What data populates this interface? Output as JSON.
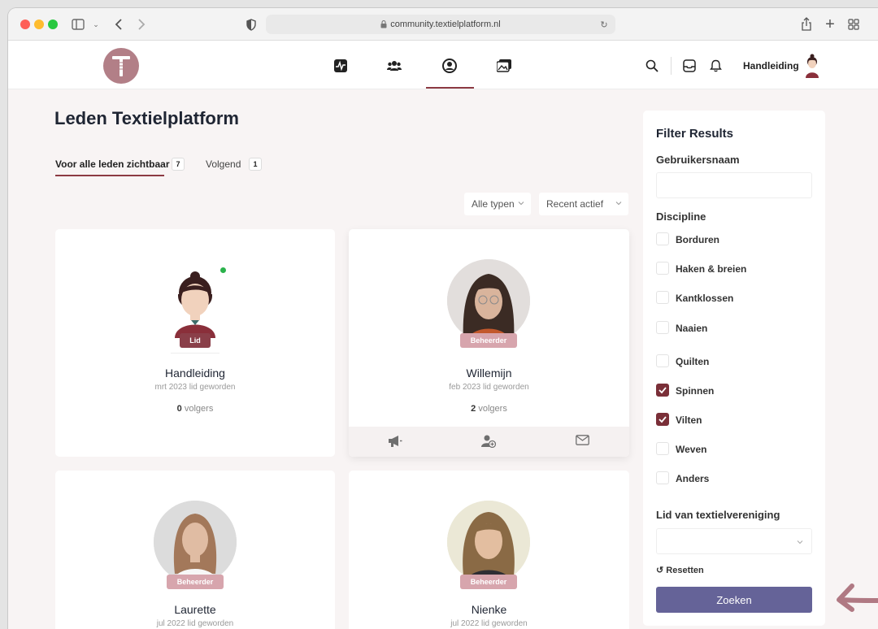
{
  "browser": {
    "url": "community.textielplatform.nl"
  },
  "header": {
    "user_name": "Handleiding"
  },
  "page": {
    "title": "Leden Textielplatform"
  },
  "tabs": [
    {
      "label": "Voor alle leden zichtbaar",
      "count": "7"
    },
    {
      "label": "Volgend",
      "count": "1"
    }
  ],
  "selects": {
    "type": "Alle typen",
    "sort": "Recent actief"
  },
  "members": [
    {
      "name": "Handleiding",
      "badge": "Lid",
      "joined": "mrt 2023 lid geworden",
      "followers": "0",
      "followers_label": "volgers"
    },
    {
      "name": "Willemijn",
      "badge": "Beheerder",
      "joined": "feb 2023 lid geworden",
      "followers": "2",
      "followers_label": "volgers"
    },
    {
      "name": "Laurette",
      "badge": "Beheerder",
      "joined": "jul 2022 lid geworden"
    },
    {
      "name": "Nienke",
      "badge": "Beheerder",
      "joined": "jul 2022 lid geworden"
    }
  ],
  "filter": {
    "title": "Filter Results",
    "username_label": "Gebruikersnaam",
    "username_value": "",
    "discipline_label": "Discipline",
    "disciplines": [
      {
        "label": "Borduren",
        "checked": false
      },
      {
        "label": "Haken & breien",
        "checked": false
      },
      {
        "label": "Kantklossen",
        "checked": false
      },
      {
        "label": "Naaien",
        "checked": false
      },
      {
        "label": "Quilten",
        "checked": false
      },
      {
        "label": "Spinnen",
        "checked": true
      },
      {
        "label": "Vilten",
        "checked": true
      },
      {
        "label": "Weven",
        "checked": false
      },
      {
        "label": "Anders",
        "checked": false
      }
    ],
    "association_label": "Lid van textielvereniging",
    "association_value": "",
    "reset_label": "Resetten",
    "search_label": "Zoeken"
  },
  "colors": {
    "accent": "#8c3a43",
    "badge_lid": "#8a3f49",
    "badge_beheerder": "#d7a5ad",
    "search_button": "#656398",
    "logo": "#b27f87",
    "online": "#2ab24b"
  }
}
